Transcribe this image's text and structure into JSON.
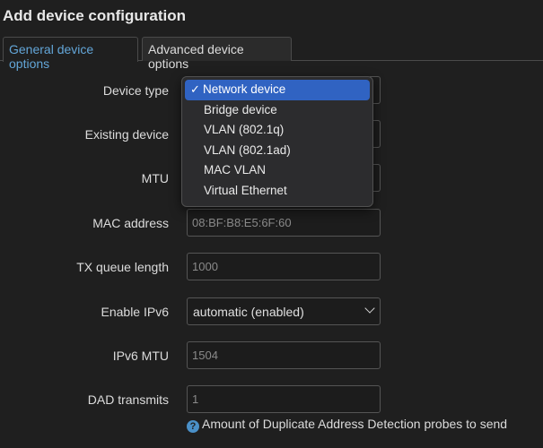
{
  "page": {
    "title": "Add device configuration"
  },
  "tabs": [
    {
      "label": "General device options",
      "active": true
    },
    {
      "label": "Advanced device options",
      "active": false
    }
  ],
  "form": {
    "device_type": {
      "label": "Device type"
    },
    "existing_device": {
      "label": "Existing device"
    },
    "mtu": {
      "label": "MTU"
    },
    "mac_address": {
      "label": "MAC address",
      "placeholder": "08:BF:B8:E5:6F:60"
    },
    "tx_queue_length": {
      "label": "TX queue length",
      "placeholder": "1000"
    },
    "enable_ipv6": {
      "label": "Enable IPv6",
      "value": "automatic (enabled)"
    },
    "ipv6_mtu": {
      "label": "IPv6 MTU",
      "placeholder": "1504"
    },
    "dad_transmits": {
      "label": "DAD transmits",
      "placeholder": "1",
      "hint": "Amount of Duplicate Address Detection probes to send",
      "hint_icon": "?"
    }
  },
  "dropdown": {
    "check": "✓",
    "options": [
      {
        "label": "Network device",
        "selected": true
      },
      {
        "label": "Bridge device",
        "selected": false
      },
      {
        "label": "VLAN (802.1q)",
        "selected": false
      },
      {
        "label": "VLAN (802.1ad)",
        "selected": false
      },
      {
        "label": "MAC VLAN",
        "selected": false
      },
      {
        "label": "Virtual Ethernet",
        "selected": false
      }
    ]
  },
  "colors": {
    "background": "#1f1f1f",
    "accent": "#63a6d8",
    "selection": "#3063c2"
  },
  "icons": [
    "checkmark-icon",
    "chevron-down-icon",
    "help-icon"
  ]
}
